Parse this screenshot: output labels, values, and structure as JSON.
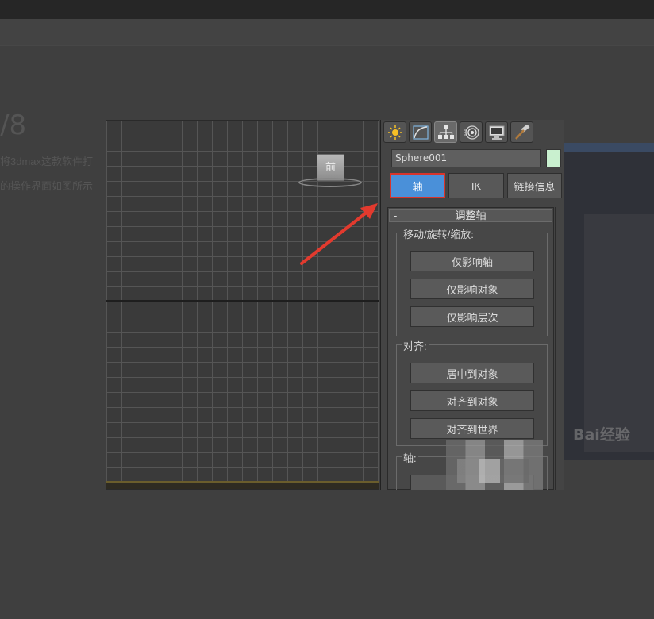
{
  "background": {
    "heading": "/8",
    "line1": "将3dmax这款软件打",
    "line2": "的操作界面如图所示"
  },
  "viewport": {
    "viewcube_label": "前"
  },
  "command_panel": {
    "tabs": [
      {
        "name": "create-tab",
        "icon": "sun-icon"
      },
      {
        "name": "modify-tab",
        "icon": "curve-icon"
      },
      {
        "name": "hierarchy-tab",
        "icon": "hierarchy-icon",
        "active": true
      },
      {
        "name": "motion-tab",
        "icon": "motion-icon"
      },
      {
        "name": "display-tab",
        "icon": "monitor-icon"
      },
      {
        "name": "utilities-tab",
        "icon": "hammer-icon"
      }
    ],
    "object_name": "Sphere001",
    "object_color": "#c9f0cf",
    "subtabs": {
      "pivot": "轴",
      "ik": "IK",
      "link_info": "链接信息"
    },
    "rollout": {
      "minus": "-",
      "title": "调整轴",
      "move_group": {
        "label": "移动/旋转/缩放:",
        "affect_pivot_only": "仅影响轴",
        "affect_object_only": "仅影响对象",
        "affect_hierarchy_only": "仅影响层次"
      },
      "align_group": {
        "label": "对齐:",
        "center_to_object": "居中到对象",
        "align_to_object": "对齐到对象",
        "align_to_world": "对齐到世界"
      },
      "axis_group": {
        "label": "轴:"
      }
    }
  },
  "watermark": "Bai经验"
}
